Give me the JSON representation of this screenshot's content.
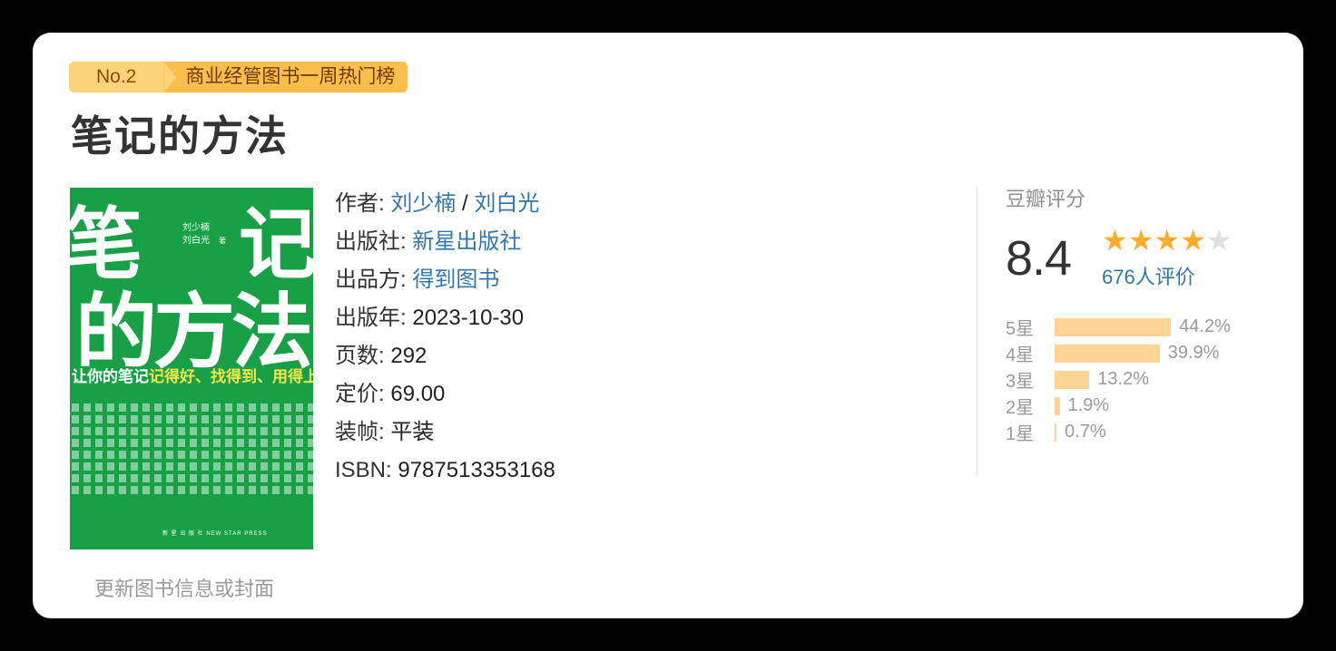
{
  "badge": {
    "rank": "No.2",
    "list": "商业经管图书一周热门榜"
  },
  "book": {
    "title": "笔记的方法",
    "cover": {
      "big1": "笔",
      "big2": "记",
      "big3": "的方法",
      "authors1": "刘少楠",
      "authors2": "刘白光",
      "zhu": "著",
      "subtitle_plain": "让你的笔记",
      "subtitle_highlight": "记得好、找得到、用得上",
      "press": "新 星 出 版 社   NEW STAR PRESS"
    },
    "update_link": "更新图书信息或封面"
  },
  "info": {
    "author_label": "作者:",
    "author1": "刘少楠",
    "author_sep": " / ",
    "author2": "刘白光",
    "publisher_label": "出版社:",
    "publisher": "新星出版社",
    "producer_label": "出品方:",
    "producer": "得到图书",
    "year_label": "出版年:",
    "year": "2023-10-30",
    "pages_label": "页数:",
    "pages": "292",
    "price_label": "定价:",
    "price": "69.00",
    "binding_label": "装帧:",
    "binding": "平装",
    "isbn_label": "ISBN:",
    "isbn": "9787513353168"
  },
  "rating": {
    "title": "豆瓣评分",
    "score": "8.4",
    "stars_filled": 4,
    "stars_total": 5,
    "count": "676人评价",
    "distribution": [
      {
        "label": "5星",
        "percent": 44.2,
        "text": "44.2%"
      },
      {
        "label": "4星",
        "percent": 39.9,
        "text": "39.9%"
      },
      {
        "label": "3星",
        "percent": 13.2,
        "text": "13.2%"
      },
      {
        "label": "2星",
        "percent": 1.9,
        "text": "1.9%"
      },
      {
        "label": "1星",
        "percent": 0.7,
        "text": "0.7%"
      }
    ],
    "bar_color": "#ffd596",
    "star_color": "#ffac2d"
  }
}
